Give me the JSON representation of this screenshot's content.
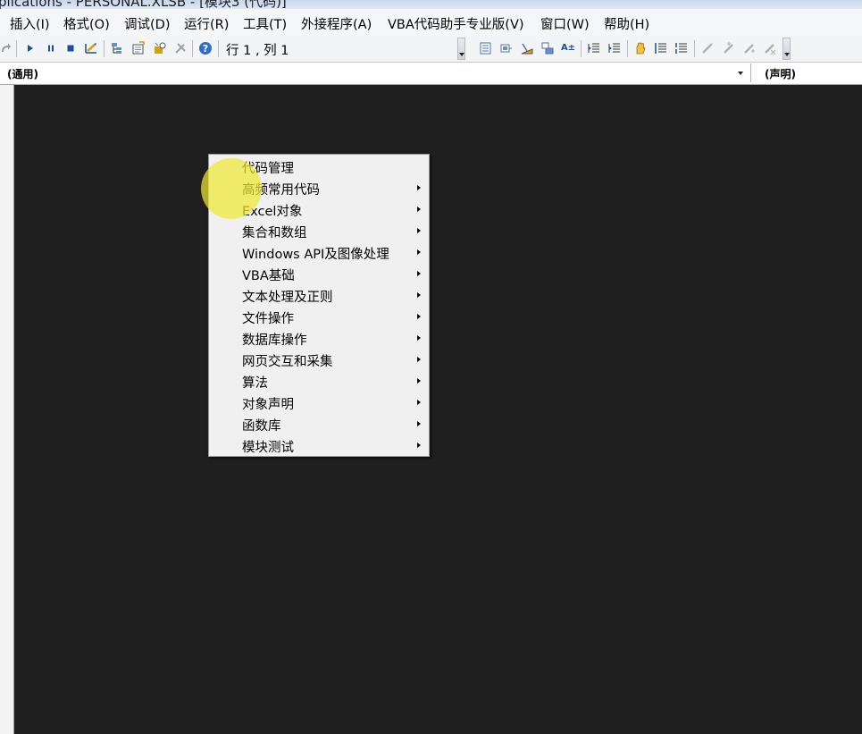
{
  "window": {
    "title_fragment": "plications - PERSONAL.XLSB - [模块3 (代码)]"
  },
  "menubar": {
    "items": [
      {
        "label": "插入(I)"
      },
      {
        "label": "格式(O)"
      },
      {
        "label": "调试(D)"
      },
      {
        "label": "运行(R)"
      },
      {
        "label": "工具(T)"
      },
      {
        "label": "外接程序(A)"
      },
      {
        "label": "VBA代码助手专业版(V)"
      },
      {
        "label": "窗口(W)"
      },
      {
        "label": "帮助(H)"
      }
    ]
  },
  "toolbar": {
    "position_text": "行 1 , 列 1",
    "icons": [
      "redo-icon",
      "run-icon",
      "break-icon",
      "reset-icon",
      "design-mode-icon",
      "project-explorer-icon",
      "properties-icon",
      "object-browser-icon",
      "toolbox-icon",
      "help-icon",
      "list-properties-icon",
      "list-constants-icon",
      "quick-info-icon",
      "parameter-info-icon",
      "complete-word-icon",
      "outdent-icon",
      "indent-icon",
      "toggle-breakpoint-icon",
      "comment-block-icon",
      "uncomment-block-icon",
      "toggle-bookmark-icon",
      "next-bookmark-icon",
      "previous-bookmark-icon",
      "clear-bookmarks-icon"
    ]
  },
  "code_window": {
    "object_combo": "(通用)",
    "procedure_combo": "(声明)"
  },
  "context_menu": {
    "items": [
      {
        "label": "代码管理",
        "submenu": false
      },
      {
        "label": "高频常用代码",
        "submenu": true
      },
      {
        "label": "Excel对象",
        "submenu": true
      },
      {
        "label": "集合和数组",
        "submenu": true
      },
      {
        "label": "Windows API及图像处理",
        "submenu": true
      },
      {
        "label": "VBA基础",
        "submenu": true
      },
      {
        "label": "文本处理及正则",
        "submenu": true
      },
      {
        "label": "文件操作",
        "submenu": true
      },
      {
        "label": "数据库操作",
        "submenu": true
      },
      {
        "label": "网页交互和采集",
        "submenu": true
      },
      {
        "label": "算法",
        "submenu": true
      },
      {
        "label": "对象声明",
        "submenu": true
      },
      {
        "label": "函数库",
        "submenu": true
      },
      {
        "label": "模块测试",
        "submenu": true
      }
    ]
  },
  "colors": {
    "editor_background": "#1f1f1f",
    "menu_background": "#f0f0f0",
    "cursor_highlight": "#eee832"
  }
}
